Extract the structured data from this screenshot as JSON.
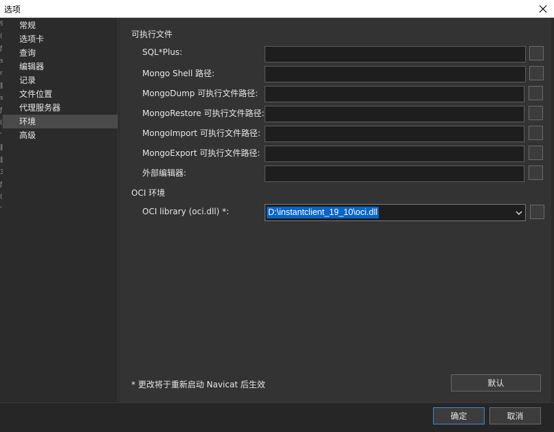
{
  "window": {
    "title": "选项"
  },
  "edge_strip": [
    "9",
    "(",
    "ƒ",
    "s",
    "r",
    "‖",
    "s",
    "ƒ",
    "(",
    "‘",
    "‖",
    "‖",
    "3",
    "ƒ",
    "(",
    "‘"
  ],
  "sidebar": {
    "items": [
      {
        "label": "常规",
        "selected": false
      },
      {
        "label": "选项卡",
        "selected": false
      },
      {
        "label": "查询",
        "selected": false
      },
      {
        "label": "编辑器",
        "selected": false
      },
      {
        "label": "记录",
        "selected": false
      },
      {
        "label": "文件位置",
        "selected": false
      },
      {
        "label": "代理服务器",
        "selected": false
      },
      {
        "label": "环境",
        "selected": true
      },
      {
        "label": "高级",
        "selected": false
      }
    ]
  },
  "main": {
    "exec_section_title": "可执行文件",
    "fields": [
      {
        "label": "SQL*Plus:",
        "value": ""
      },
      {
        "label": "Mongo Shell 路径:",
        "value": ""
      },
      {
        "label": "MongoDump 可执行文件路径:",
        "value": ""
      },
      {
        "label": "MongoRestore 可执行文件路径:",
        "value": ""
      },
      {
        "label": "MongoImport 可执行文件路径:",
        "value": ""
      },
      {
        "label": "MongoExport 可执行文件路径:",
        "value": ""
      },
      {
        "label": "外部编辑器:",
        "value": ""
      }
    ],
    "oci_section_title": "OCI 环境",
    "oci_label": "OCI library (oci.dll) *:",
    "oci_value": "D:\\instantclient_19_10\\oci.dll",
    "note": "* 更改将于重新启动 Navicat 后生效",
    "default_button": "默认"
  },
  "footer": {
    "ok_button": "确定",
    "cancel_button": "取消"
  },
  "colors": {
    "selection": "#0a64c8",
    "ok_border": "#3a8be0",
    "background": "#2b2b2b"
  }
}
